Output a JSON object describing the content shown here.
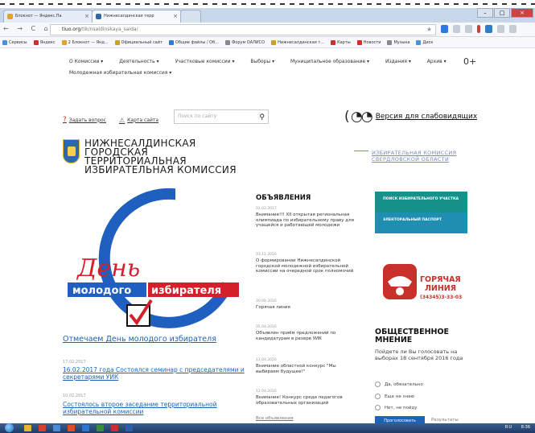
{
  "browser": {
    "tabs": [
      {
        "label": "Блокнот — Яндекс.Па",
        "active": false
      },
      {
        "label": "Нижнесалдинская терр",
        "active": true
      }
    ],
    "url_host": "tiuo.org",
    "url_path": "/tik/nsaldinskaya_saida/",
    "bookmarks": [
      "Сервисы",
      "Яндекс",
      "2 Блокнот — Янд...",
      "Официальный сайт",
      "Общие файлы / Об...",
      "Форум ОАЛИСО",
      "Нижнесалдинская т...",
      "Карты",
      "Новости",
      "Музыка",
      "Диск"
    ]
  },
  "menu": {
    "items": [
      "О Комиссии",
      "Деятельность",
      "Участковые комиссии",
      "Выборы",
      "Муниципальное образование",
      "Издания",
      "Архив"
    ],
    "row2": "Молодежная избирательная комиссия",
    "zoom_icon": "0+"
  },
  "util": {
    "ask_label": "Задать вопрос",
    "map_label": "Карта сайта",
    "search_placeholder": "Поиск по сайту",
    "vision_label": "Версия для слабовидящих"
  },
  "header": {
    "org_line1": "НИЖНЕСАЛДИНСКАЯ",
    "org_line2": "ГОРОДСКАЯ",
    "org_line3": "ТЕРРИТОРИАЛЬНАЯ",
    "org_line4": "ИЗБИРАТЕЛЬНАЯ КОМИССИЯ",
    "regional_line1": "ИЗБИРАТЕЛЬНАЯ КОМИССИЯ",
    "regional_line2": "СВЕРДЛОВСКОЙ ОБЛАСТИ"
  },
  "banner": {
    "word1": "День",
    "word2": "молодого",
    "word3": "избирателя"
  },
  "promo_link": "Отмечаем День молодого избирателя",
  "news": [
    {
      "date": "17.02.2017",
      "title": "16.02.2017 года Состоялся семинар с председателями и секретарями УИК"
    },
    {
      "date": "10.02.2017",
      "title": "Состоялось второе заседание территориальной избирательной комиссии"
    }
  ],
  "announcements": {
    "title": "ОБЪЯВЛЕНИЯ",
    "items": [
      {
        "date": "01.03.2017",
        "text": "Внимание!!! XII открытая региональная олимпиада по избирательному праву для учащейся и работающей молодежи"
      },
      {
        "date": "03.11.2016",
        "text": "О формировании Нижнесалдинской городской молодежной избирательной комиссии на очередной срок полномочий"
      },
      {
        "date": "30.08.2016",
        "text": "Горячая линия"
      },
      {
        "date": "05.04.2016",
        "text": "Объявлен приём предложений по кандидатурам в резерв УИК"
      },
      {
        "date": "12.04.2016",
        "text": "Внимание областной конкурс \"Мы выбираем будущее!\""
      },
      {
        "date": "12.04.2016",
        "text": "Внимание! Конкурс среди педагогов образовательных организаций"
      }
    ],
    "all_label": "Все объявления"
  },
  "sidebar": {
    "teal1": "ПОИСК ИЗБИРАТЕЛЬНОГО УЧАСТКА",
    "teal2": "ЭЛЕКТОРАЛЬНЫЙ ПАСПОРТ",
    "hotline_line1": "ГОРЯЧАЯ",
    "hotline_line2": "ЛИНИЯ",
    "hotline_phone": "(34345)3-33-03"
  },
  "poll": {
    "title_line1": "ОБЩЕСТВЕННОЕ",
    "title_line2": "МНЕНИЕ",
    "question": "Пойдете ли Вы голосовать на выборах 18 сентября 2016 года",
    "options": [
      "Да, обязательно",
      "Еще не знаю",
      "Нет, не пойду"
    ],
    "vote_label": "Проголосовать",
    "results_label": "Результаты"
  },
  "taskbar": {
    "tray_text": "RU",
    "clock": "8:36"
  },
  "colors": {
    "link": "#1d63b7",
    "teal": "#17928a",
    "hotline_red": "#c8302a",
    "banner_red": "#d3202a",
    "banner_blue": "#1f5fbf"
  }
}
